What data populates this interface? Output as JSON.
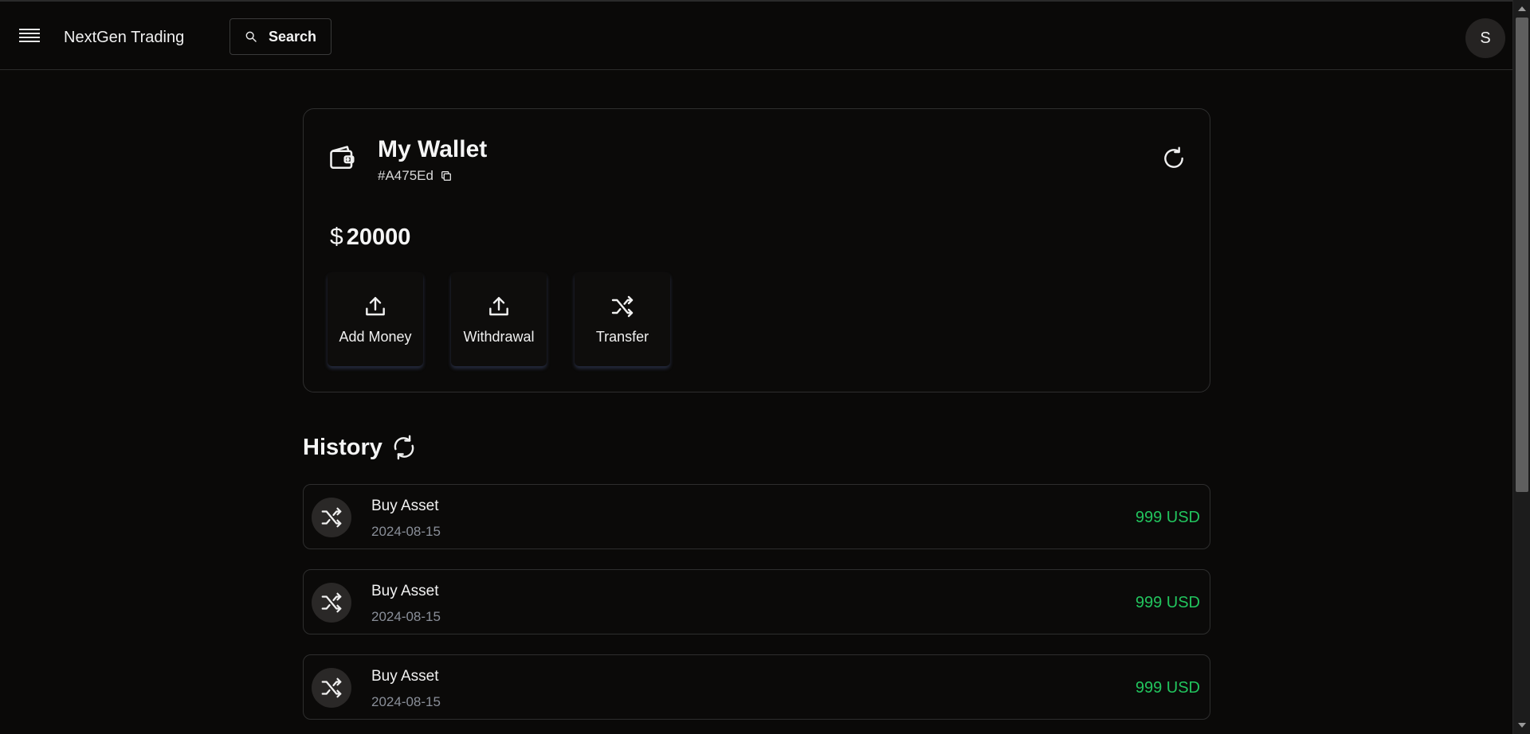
{
  "header": {
    "app_title": "NextGen Trading",
    "search_label": "Search",
    "avatar_initial": "S"
  },
  "wallet": {
    "title": "My Wallet",
    "id": "#A475Ed",
    "currency_symbol": "$",
    "balance": "20000",
    "actions": [
      {
        "label": "Add Money",
        "icon": "upload-icon"
      },
      {
        "label": "Withdrawal",
        "icon": "upload-icon"
      },
      {
        "label": "Transfer",
        "icon": "shuffle-icon"
      }
    ]
  },
  "history": {
    "title": "History",
    "items": [
      {
        "title": "Buy Asset",
        "date": "2024-08-15",
        "amount": "999 USD",
        "icon": "shuffle-icon"
      },
      {
        "title": "Buy Asset",
        "date": "2024-08-15",
        "amount": "999 USD",
        "icon": "shuffle-icon"
      },
      {
        "title": "Buy Asset",
        "date": "2024-08-15",
        "amount": "999 USD",
        "icon": "shuffle-icon"
      }
    ]
  },
  "colors": {
    "background": "#0a0908",
    "card_border": "#2e2e2e",
    "amount_positive": "#22c55e",
    "muted_text": "#8a8f99"
  }
}
